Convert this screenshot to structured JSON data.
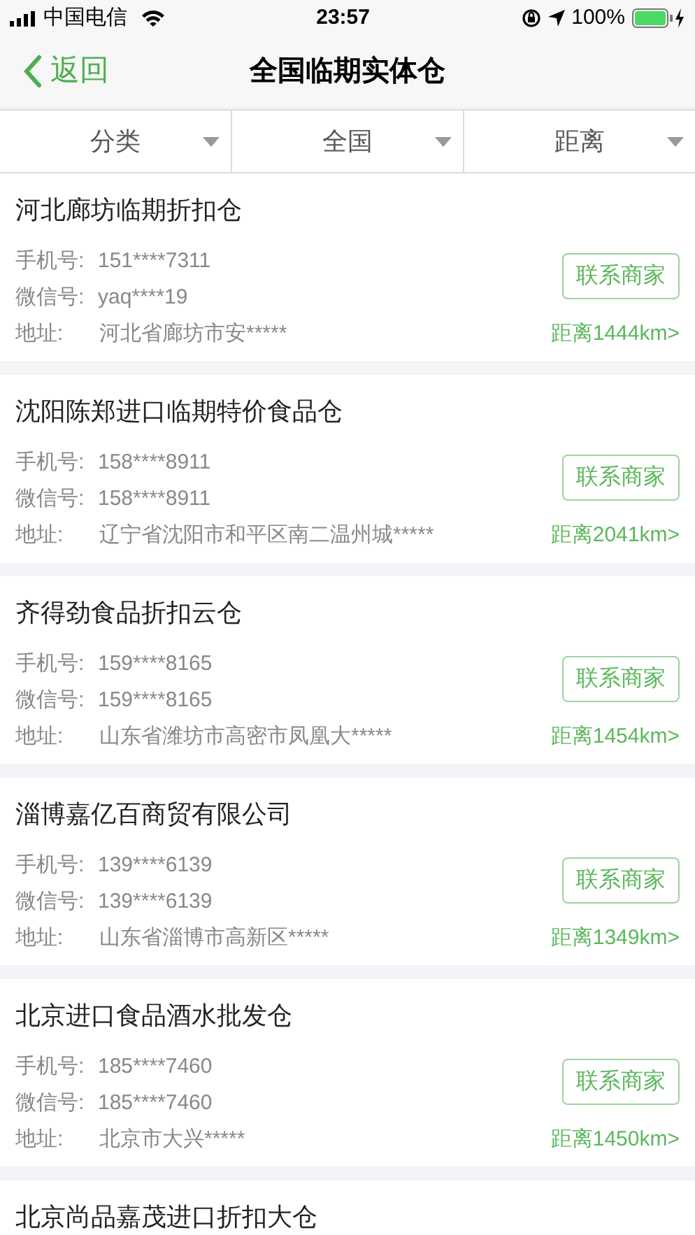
{
  "status_bar": {
    "carrier": "中国电信",
    "time": "23:57",
    "battery": "100%"
  },
  "nav": {
    "back": "返回",
    "title": "全国临期实体仓"
  },
  "filters": [
    {
      "label": "分类"
    },
    {
      "label": "全国"
    },
    {
      "label": "距离"
    }
  ],
  "stores": [
    {
      "name": "河北廊坊临期折扣仓",
      "phone_label": "手机号:",
      "phone": "151****7311",
      "wechat_label": "微信号:",
      "wechat": "yaq****19",
      "address_label": "地址:",
      "address": "河北省廊坊市安*****",
      "button": "联系商家",
      "distance": "距离1444km>"
    },
    {
      "name": "沈阳陈郑进口临期特价食品仓",
      "phone_label": "手机号:",
      "phone": "158****8911",
      "wechat_label": "微信号:",
      "wechat": "158****8911",
      "address_label": "地址:",
      "address": "辽宁省沈阳市和平区南二温州城*****",
      "button": "联系商家",
      "distance": "距离2041km>"
    },
    {
      "name": "齐得劲食品折扣云仓",
      "phone_label": "手机号:",
      "phone": "159****8165",
      "wechat_label": "微信号:",
      "wechat": "159****8165",
      "address_label": "地址:",
      "address": "山东省潍坊市高密市凤凰大*****",
      "button": "联系商家",
      "distance": "距离1454km>"
    },
    {
      "name": "淄博嘉亿百商贸有限公司",
      "phone_label": "手机号:",
      "phone": "139****6139",
      "wechat_label": "微信号:",
      "wechat": "139****6139",
      "address_label": "地址:",
      "address": "山东省淄博市高新区*****",
      "button": "联系商家",
      "distance": "距离1349km>"
    },
    {
      "name": "北京进口食品酒水批发仓",
      "phone_label": "手机号:",
      "phone": "185****7460",
      "wechat_label": "微信号:",
      "wechat": "185****7460",
      "address_label": "地址:",
      "address": "北京市大兴*****",
      "button": "联系商家",
      "distance": "距离1450km>"
    },
    {
      "name": "北京尚品嘉茂进口折扣大仓"
    }
  ]
}
